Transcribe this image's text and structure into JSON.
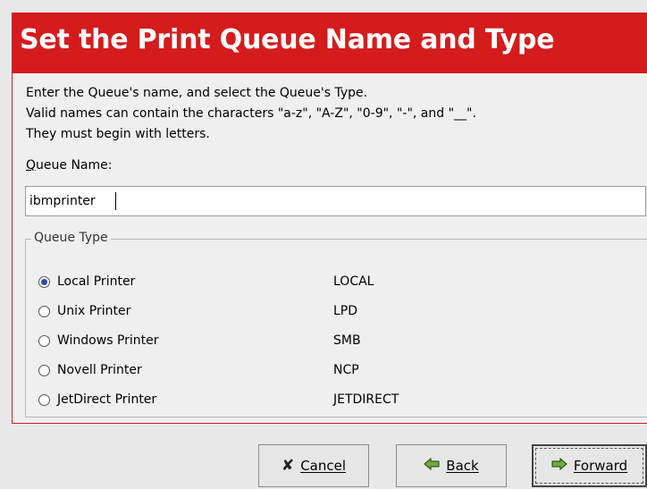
{
  "header": {
    "title": "Set the Print Queue Name and Type"
  },
  "description": {
    "line1": "Enter the Queue's name, and select the Queue's Type.",
    "line2": "Valid names can contain the characters \"a-z\", \"A-Z\", \"0-9\", \"-\", and \"__\".",
    "line3": "They must begin with letters."
  },
  "queue_name": {
    "label": "Queue Name:",
    "value": "ibmprinter"
  },
  "queue_type": {
    "legend": "Queue Type",
    "options": [
      {
        "label": "Local Printer",
        "code": "LOCAL",
        "selected": true
      },
      {
        "label": "Unix Printer",
        "code": "LPD",
        "selected": false
      },
      {
        "label": "Windows Printer",
        "code": "SMB",
        "selected": false
      },
      {
        "label": "Novell Printer",
        "code": "NCP",
        "selected": false
      },
      {
        "label": "JetDirect Printer",
        "code": "JETDIRECT",
        "selected": false
      }
    ]
  },
  "buttons": {
    "cancel": {
      "label": "Cancel",
      "icon": "cancel-x-icon"
    },
    "back": {
      "label": "Back",
      "icon": "arrow-left-icon"
    },
    "forward": {
      "label": "Forward",
      "icon": "arrow-right-icon"
    }
  },
  "colors": {
    "header_bg": "#d41c1c",
    "radio_dot": "#2a4fa8"
  }
}
